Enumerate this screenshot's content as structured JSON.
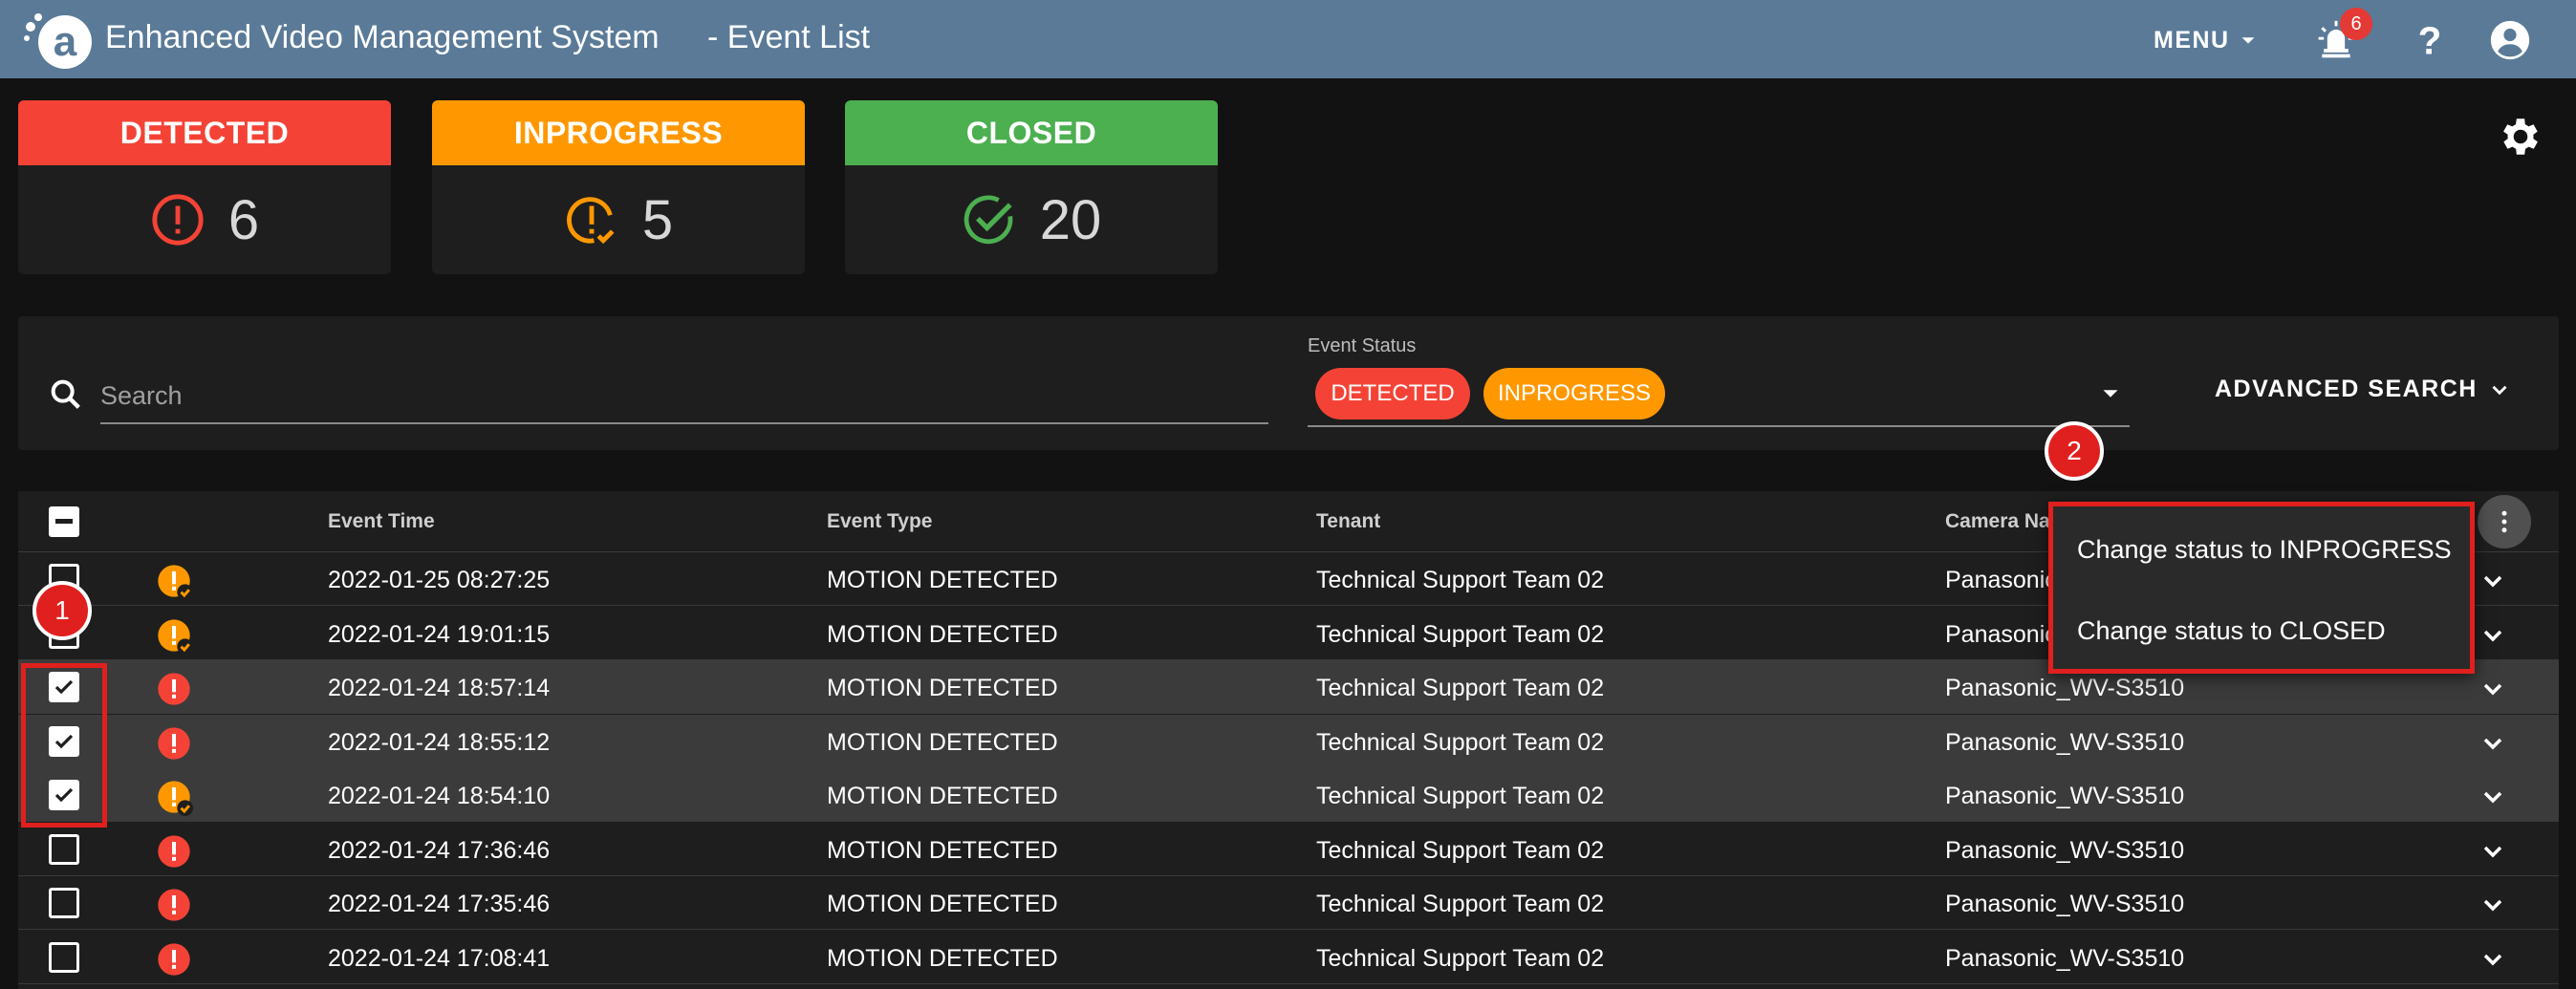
{
  "header": {
    "app_title": "Enhanced Video Management System",
    "page_title": "- Event List",
    "menu_label": "MENU",
    "notification_count": "6"
  },
  "cards": [
    {
      "label": "DETECTED",
      "count": "6",
      "color": "#f44336",
      "icon": "alert-circle-icon"
    },
    {
      "label": "INPROGRESS",
      "count": "5",
      "color": "#ff9800",
      "icon": "alert-clock-icon"
    },
    {
      "label": "CLOSED",
      "count": "20",
      "color": "#4caf50",
      "icon": "check-circle-icon"
    }
  ],
  "search": {
    "placeholder": "Search",
    "status_label": "Event Status",
    "chips": [
      "DETECTED",
      "INPROGRESS"
    ],
    "advanced_label": "ADVANCED SEARCH"
  },
  "table": {
    "headers": [
      "Event Time",
      "Event Type",
      "Tenant",
      "Camera Na"
    ],
    "rows": [
      {
        "time": "2022-01-25 08:27:25",
        "type": "MOTION DETECTED",
        "tenant": "Technical Support Team 02",
        "camera": "Panasonic",
        "status": "inprogress",
        "checked": false
      },
      {
        "time": "2022-01-24 19:01:15",
        "type": "MOTION DETECTED",
        "tenant": "Technical Support Team 02",
        "camera": "Panasonic",
        "status": "inprogress",
        "checked": false
      },
      {
        "time": "2022-01-24 18:57:14",
        "type": "MOTION DETECTED",
        "tenant": "Technical Support Team 02",
        "camera": "Panasonic_WV-S3510",
        "status": "detected",
        "checked": true
      },
      {
        "time": "2022-01-24 18:55:12",
        "type": "MOTION DETECTED",
        "tenant": "Technical Support Team 02",
        "camera": "Panasonic_WV-S3510",
        "status": "detected",
        "checked": true
      },
      {
        "time": "2022-01-24 18:54:10",
        "type": "MOTION DETECTED",
        "tenant": "Technical Support Team 02",
        "camera": "Panasonic_WV-S3510",
        "status": "inprogress",
        "checked": true
      },
      {
        "time": "2022-01-24 17:36:46",
        "type": "MOTION DETECTED",
        "tenant": "Technical Support Team 02",
        "camera": "Panasonic_WV-S3510",
        "status": "detected",
        "checked": false
      },
      {
        "time": "2022-01-24 17:35:46",
        "type": "MOTION DETECTED",
        "tenant": "Technical Support Team 02",
        "camera": "Panasonic_WV-S3510",
        "status": "detected",
        "checked": false
      },
      {
        "time": "2022-01-24 17:08:41",
        "type": "MOTION DETECTED",
        "tenant": "Technical Support Team 02",
        "camera": "Panasonic_WV-S3510",
        "status": "detected",
        "checked": false
      }
    ]
  },
  "dropdown": {
    "items": [
      "Change status to INPROGRESS",
      "Change status to CLOSED"
    ]
  },
  "annotations": [
    "1",
    "2"
  ],
  "colors": {
    "header_bg": "#5a7a98",
    "detected": "#f44336",
    "inprogress": "#ff9800",
    "closed": "#4caf50",
    "annotation": "#e0201e"
  }
}
